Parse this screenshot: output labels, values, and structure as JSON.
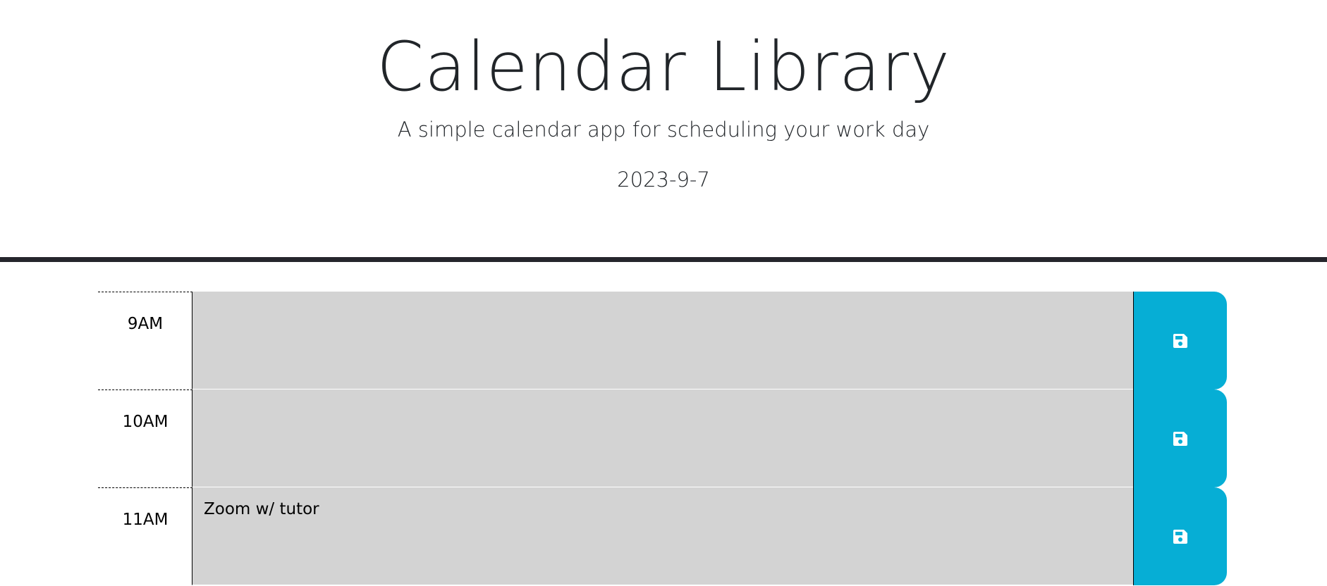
{
  "header": {
    "title": "Calendar Library",
    "subtitle": "A simple calendar app for scheduling your work day",
    "current_date": "2023-9-7"
  },
  "colors": {
    "past_block": "#d3d3d3",
    "save_button": "#06aed5",
    "header_border": "#25262c"
  },
  "schedule": [
    {
      "hour": "9AM",
      "description": "",
      "save_icon": "save-icon"
    },
    {
      "hour": "10AM",
      "description": "",
      "save_icon": "save-icon"
    },
    {
      "hour": "11AM",
      "description": "Zoom w/ tutor",
      "save_icon": "save-icon"
    }
  ]
}
